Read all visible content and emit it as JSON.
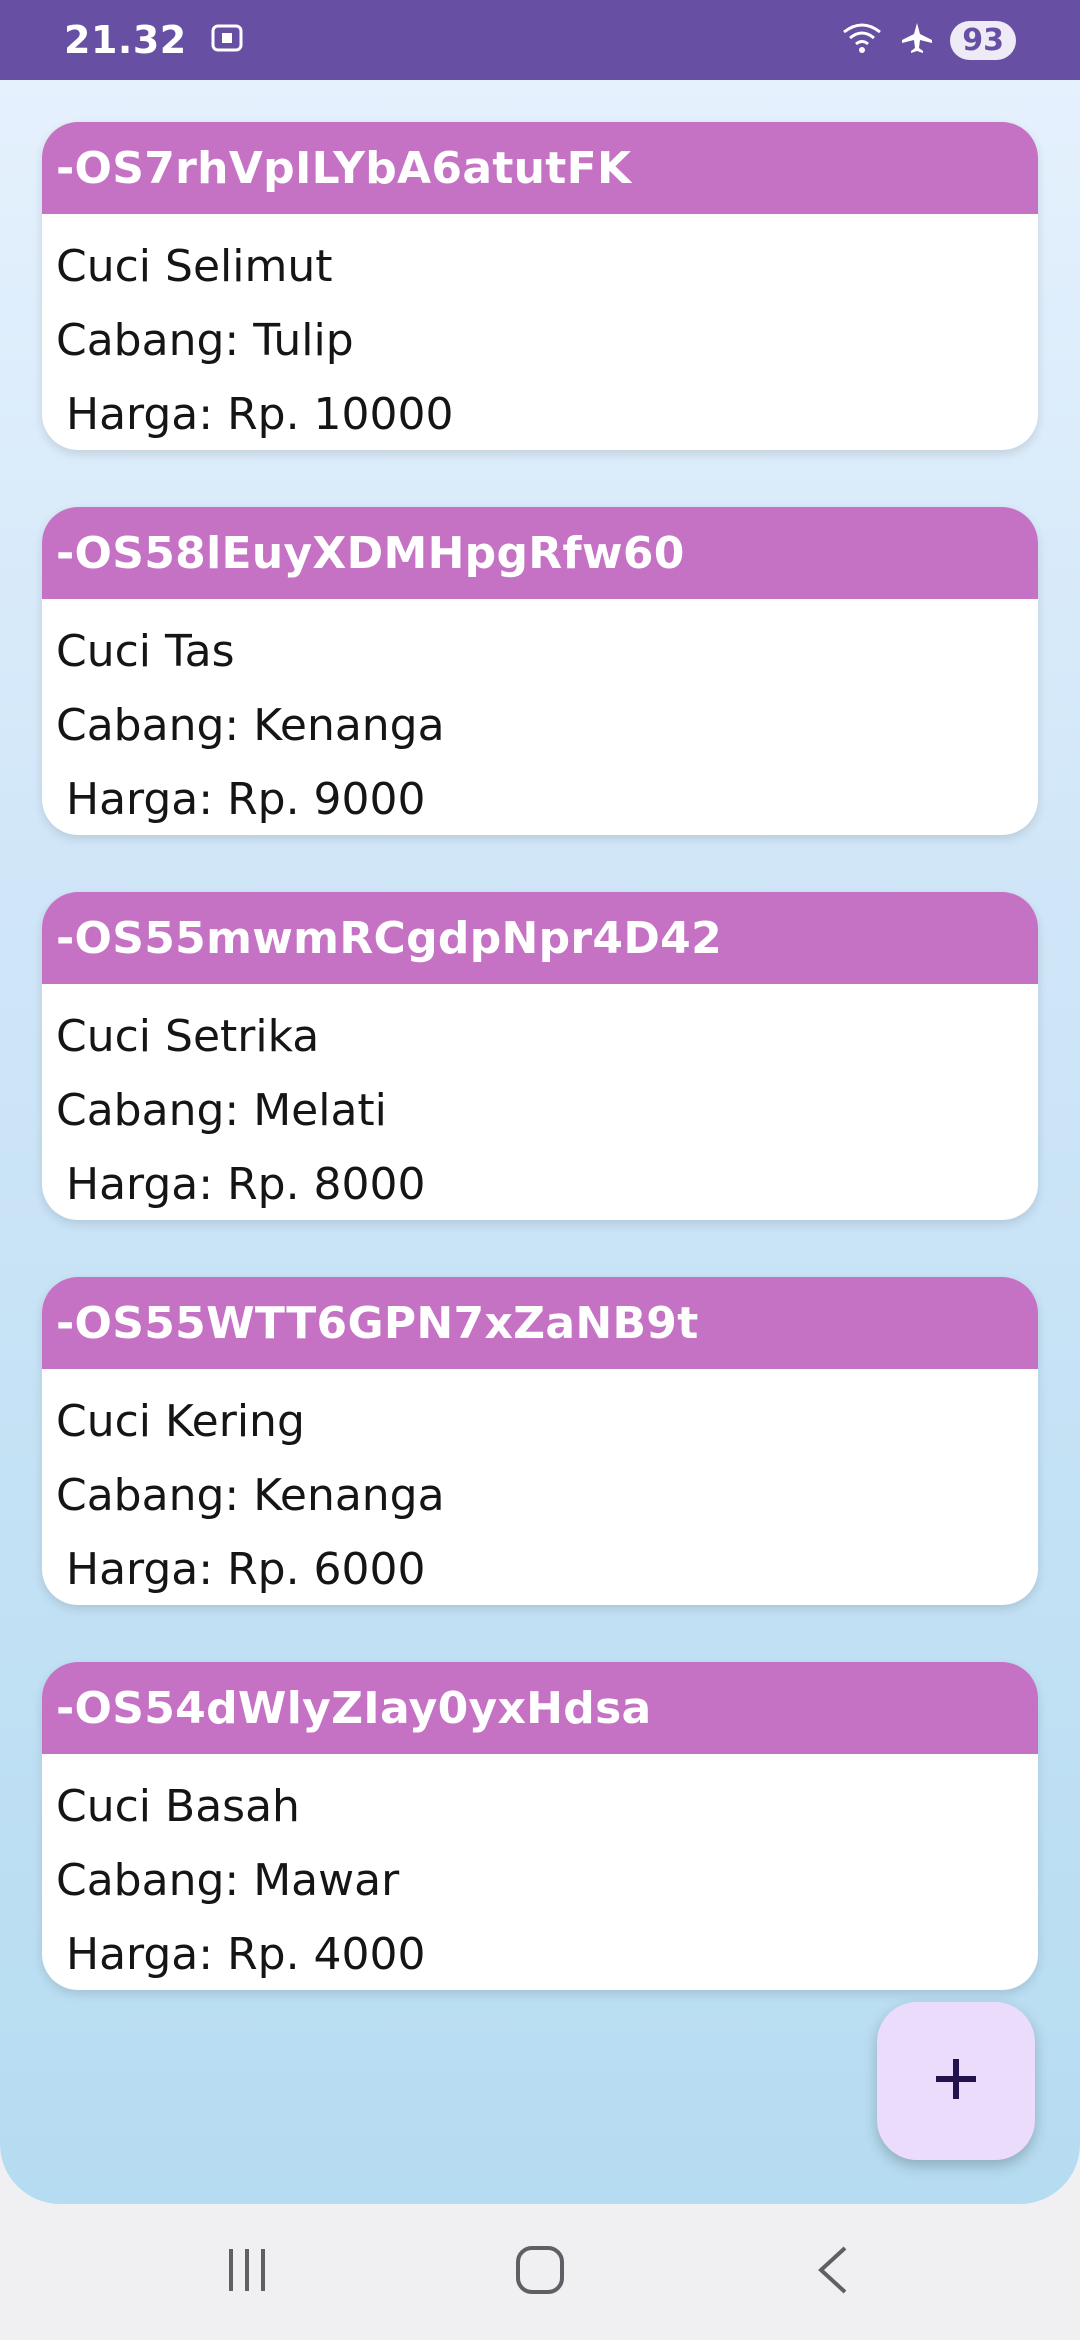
{
  "status_bar": {
    "time": "21.32",
    "battery": "93",
    "icons": [
      "screenshot-icon",
      "wifi-icon",
      "airplane-mode-icon"
    ]
  },
  "items": [
    {
      "id": "-OS7rhVpILYbA6atutFK",
      "name": "Cuci Selimut",
      "branch": "Cabang: Tulip",
      "price": "Harga: Rp. 10000"
    },
    {
      "id": "-OS58lEuyXDMHpgRfw60",
      "name": "Cuci Tas",
      "branch": "Cabang: Kenanga",
      "price": "Harga: Rp. 9000"
    },
    {
      "id": "-OS55mwmRCgdpNpr4D42",
      "name": "Cuci Setrika",
      "branch": "Cabang: Melati",
      "price": "Harga: Rp. 8000"
    },
    {
      "id": "-OS55WTT6GPN7xZaNB9t",
      "name": "Cuci Kering",
      "branch": "Cabang: Kenanga",
      "price": "Harga: Rp. 6000"
    },
    {
      "id": "-OS54dWlyZIay0yxHdsa",
      "name": "Cuci Basah",
      "branch": "Cabang: Mawar",
      "price": "Harga: Rp. 4000"
    }
  ],
  "fab": {
    "icon": "plus-icon"
  },
  "nav_bar": {
    "icons": [
      "recent-apps-icon",
      "home-icon",
      "back-icon"
    ]
  },
  "colors": {
    "status_bar": "#6750a4",
    "card_header": "#c572c4",
    "fab_background": "#ebdcfc",
    "fab_icon": "#23134d"
  }
}
